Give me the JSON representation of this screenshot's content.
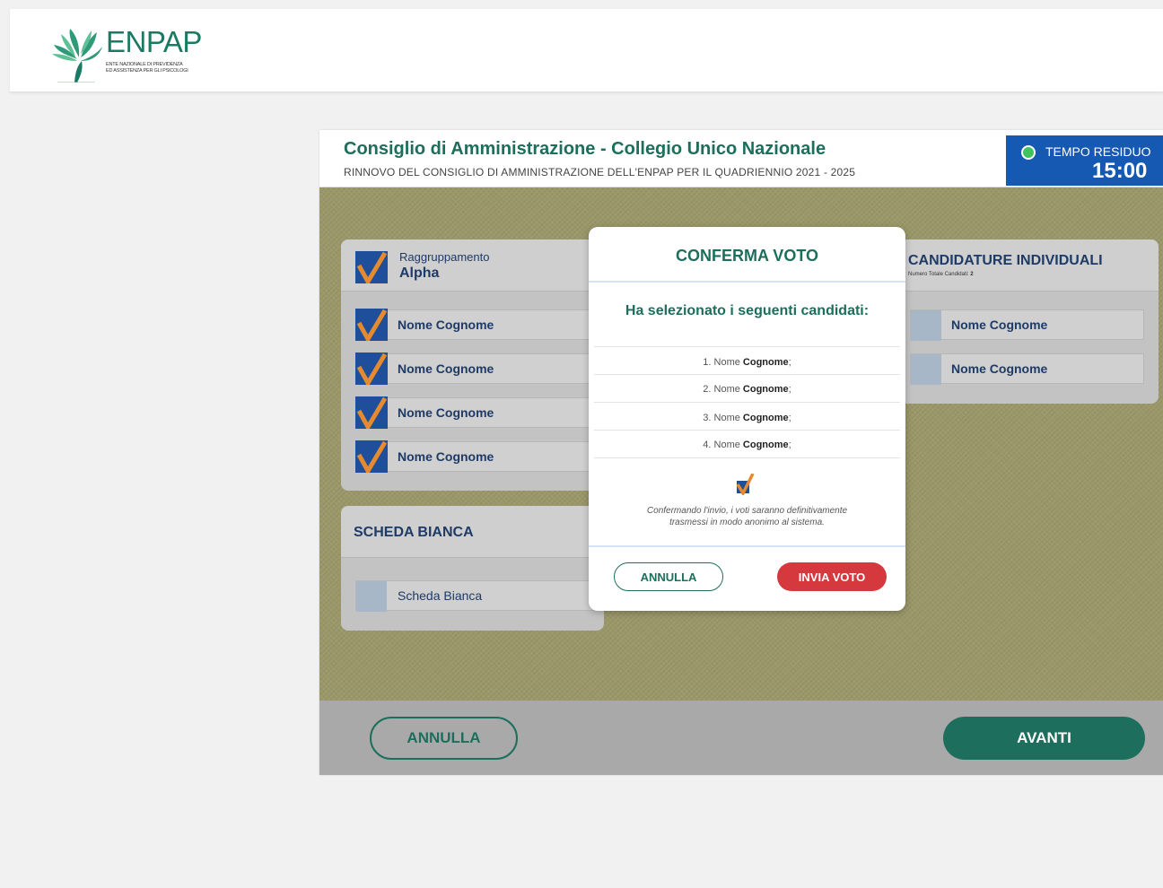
{
  "logo": {
    "name": "ENPAP",
    "subtitle_line1": "ENTE NAZIONALE DI PREVIDENZA",
    "subtitle_line2": "ED ASSISTENZA PER GLI PSICOLOGI"
  },
  "ballot": {
    "title": "Consiglio di Amministrazione - Collegio Unico Nazionale",
    "subtitle": "RINNOVO DEL CONSIGLIO DI AMMINISTRAZIONE DELL'ENPAP PER IL QUADRIENNIO 2021 - 2025"
  },
  "timer": {
    "label": "TEMPO RESIDUO",
    "value": "15:00",
    "status_color": "#3fc35f"
  },
  "group": {
    "label": "Raggruppamento",
    "name": "Alpha",
    "candidates": [
      "Nome Cognome",
      "Nome Cognome",
      "Nome Cognome",
      "Nome Cognome"
    ]
  },
  "blank": {
    "title": "SCHEDA BIANCA",
    "option": "Scheda Bianca"
  },
  "individual": {
    "title": "CANDIDATURE INDIVIDUALI",
    "count_label": "Numero Totale Candidati:",
    "count": "2",
    "candidates": [
      "Nome Cognome",
      "Nome Cognome"
    ]
  },
  "footer": {
    "cancel": "ANNULLA",
    "next": "AVANTI"
  },
  "modal": {
    "title": "CONFERMA VOTO",
    "lead": "Ha selezionato i seguenti candidati:",
    "selections": [
      {
        "num": "1.",
        "first": "Nome",
        "last": "Cognome"
      },
      {
        "num": "2.",
        "first": "Nome",
        "last": "Cognome"
      },
      {
        "num": "3.",
        "first": "Nome",
        "last": "Cognome"
      },
      {
        "num": "4.",
        "first": "Nome",
        "last": "Cognome"
      }
    ],
    "note_line1": "Confermando l'invio, i voti saranno definitivamente",
    "note_line2": "trasmessi in modo anonimo al sistema.",
    "cancel": "ANNULLA",
    "send": "INVIA VOTO"
  },
  "colors": {
    "brand_green": "#1d6e5c",
    "timer_blue": "#1559b3",
    "send_red": "#d5383d"
  }
}
